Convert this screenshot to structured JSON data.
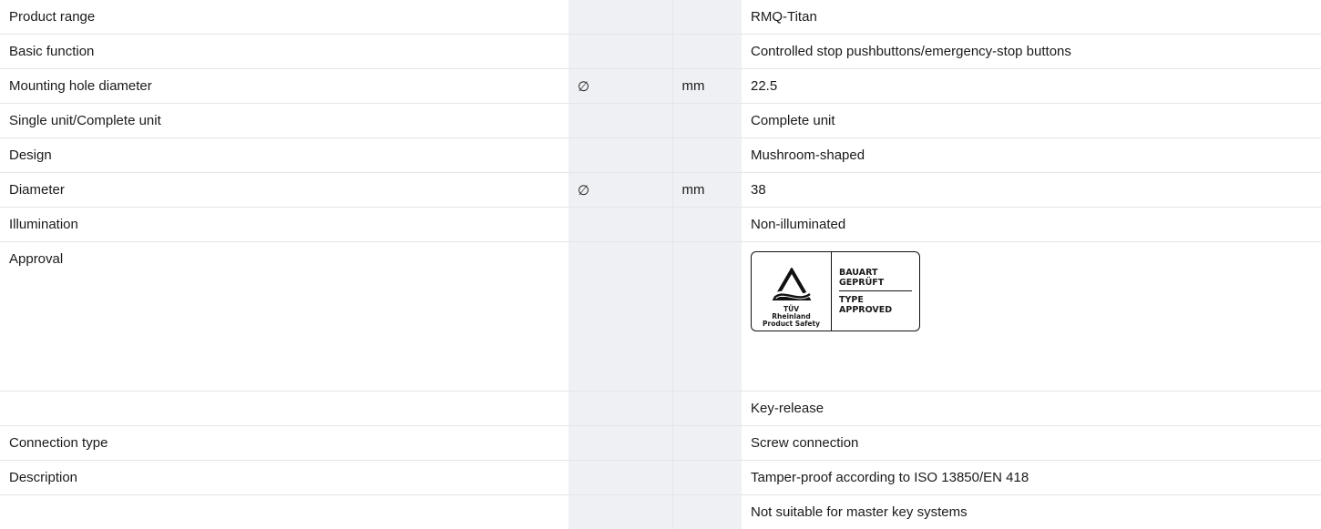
{
  "rows": [
    {
      "label": "Product range",
      "symbol": "",
      "unit": "",
      "value": "RMQ-Titan"
    },
    {
      "label": "Basic function",
      "symbol": "",
      "unit": "",
      "value": "Controlled stop pushbuttons/emergency-stop buttons"
    },
    {
      "label": "Mounting hole diameter",
      "symbol": "∅",
      "unit": "mm",
      "value": "22.5"
    },
    {
      "label": "Single unit/Complete unit",
      "symbol": "",
      "unit": "",
      "value": "Complete unit"
    },
    {
      "label": "Design",
      "symbol": "",
      "unit": "",
      "value": "Mushroom-shaped"
    },
    {
      "label": "Diameter",
      "symbol": "∅",
      "unit": "mm",
      "value": "38"
    },
    {
      "label": "Illumination",
      "symbol": "",
      "unit": "",
      "value": "Non-illuminated"
    },
    {
      "label": "Approval",
      "symbol": "",
      "unit": "",
      "value": ""
    },
    {
      "label": "",
      "symbol": "",
      "unit": "",
      "value": "Key-release"
    },
    {
      "label": "Connection type",
      "symbol": "",
      "unit": "",
      "value": "Screw connection"
    },
    {
      "label": "Description",
      "symbol": "",
      "unit": "",
      "value": "Tamper-proof according to ISO 13850/EN 418"
    },
    {
      "label": "",
      "symbol": "",
      "unit": "",
      "value": "Not suitable for master key systems"
    }
  ],
  "approval_logo": {
    "icon": "tuv-triangle-icon",
    "brand_line1": "TÜV",
    "brand_line2": "Rheinland",
    "brand_line3": "Product Safety",
    "text_top_1": "BAUART",
    "text_top_2": "GEPRÜFT",
    "text_bottom_1": "TYPE",
    "text_bottom_2": "APPROVED"
  },
  "colors": {
    "unit_column_bg": "#eef0f3",
    "divider": "#e3e5e8",
    "text": "#1a1a1a"
  }
}
